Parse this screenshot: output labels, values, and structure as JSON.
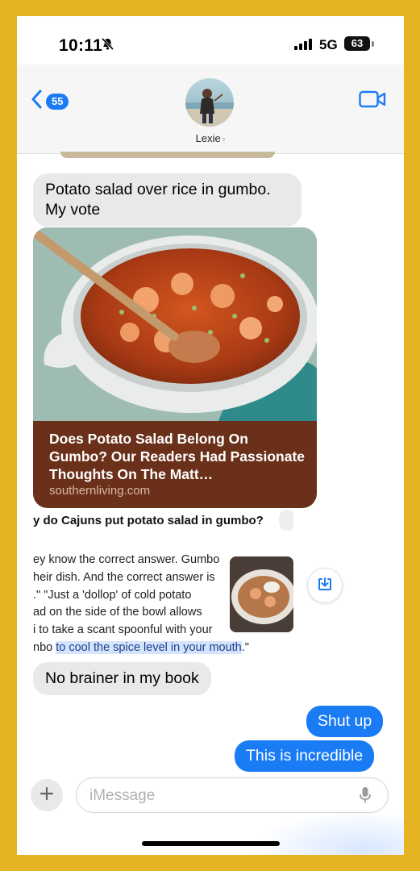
{
  "status_bar": {
    "time": "10:11",
    "network": "5G",
    "battery": "63"
  },
  "header": {
    "back_count": "55",
    "contact_name": "Lexie",
    "contact_chevron": "›"
  },
  "messages": {
    "m1": "Potato salad over rice in gumbo. My vote",
    "m2": "No brainer in my book",
    "m3": "Shut up",
    "m4": "This is incredible"
  },
  "link_preview": {
    "title": "Does Potato Salad Belong On Gumbo? Our Readers Had Passionate Thoughts On The Matt…",
    "domain": "southernliving.com"
  },
  "snippet": {
    "question": "y do Cajuns put potato salad in gumbo?",
    "lines": [
      "ey know the correct answer. Gumbo",
      "heir dish. And the correct answer is",
      ".\" \"Just a 'dollop' of cold potato",
      "ad on the side of the bowl allows",
      "i to take a scant spoonful with your"
    ],
    "last_prefix": "nbo ",
    "highlight": "to cool the spice level in your mouth",
    "last_suffix": ".\""
  },
  "input": {
    "placeholder": "iMessage"
  },
  "colors": {
    "frame": "#e6b322",
    "blue_bubble": "#1a7cf5",
    "gray_bubble": "#e9e9eb",
    "link_card": "#6b3019"
  }
}
